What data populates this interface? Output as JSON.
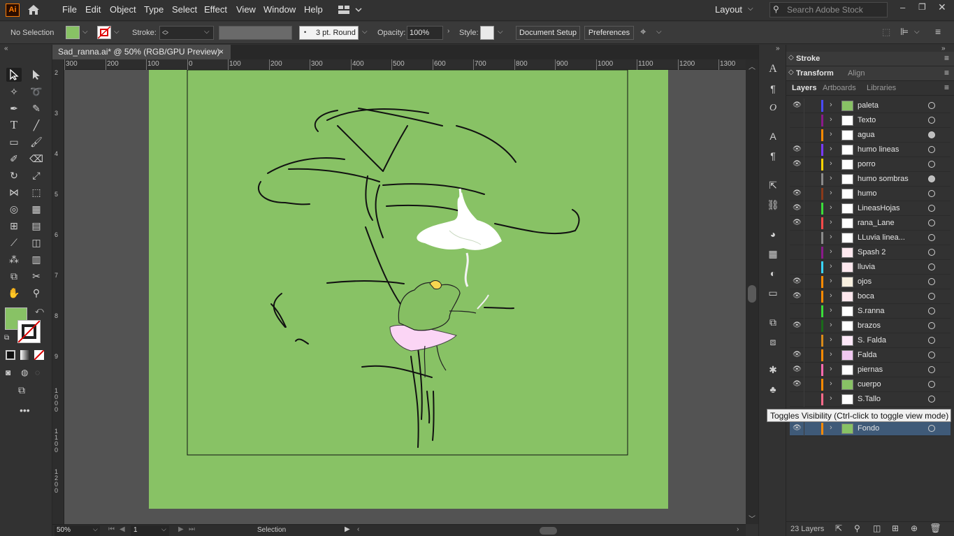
{
  "app": {
    "logo": "Ai"
  },
  "menu": [
    "File",
    "Edit",
    "Object",
    "Type",
    "Select",
    "Effect",
    "View",
    "Window",
    "Help"
  ],
  "workspace": "Layout",
  "search_placeholder": "Search Adobe Stock",
  "control": {
    "selection": "No Selection",
    "fill_color": "#88c265",
    "stroke_label": "Stroke:",
    "brush": "3 pt. Round",
    "opacity_label": "Opacity:",
    "opacity": "100%",
    "style_label": "Style:",
    "doc_setup": "Document Setup",
    "preferences": "Preferences"
  },
  "document_tab": {
    "title": "Sad_ranna.ai* @ 50% (RGB/GPU Preview)",
    "close": "×"
  },
  "ruler_h": [
    "300",
    "200",
    "100",
    "0",
    "100",
    "200",
    "300",
    "400",
    "500",
    "600",
    "700",
    "800",
    "900",
    "1000",
    "1100",
    "1200",
    "1300"
  ],
  "ruler_v": [
    "2",
    "3",
    "4",
    "5",
    "6",
    "7",
    "8",
    "9",
    "1\n0\n0\n0",
    "1\n1\n0\n0",
    "1\n2\n0\n0"
  ],
  "status": {
    "zoom": "50%",
    "artboard": "1",
    "tool": "Selection"
  },
  "panels": {
    "stroke": "Stroke",
    "transform": "Transform",
    "align": "Align",
    "layers": "Layers",
    "artboards": "Artboards",
    "libraries": "Libraries"
  },
  "layers": [
    {
      "name": "paleta",
      "color": "#4a4aff",
      "visible": true,
      "thumb": "#88c265"
    },
    {
      "name": "Texto",
      "color": "#8a1a8a",
      "visible": false,
      "thumb": "#ffffff"
    },
    {
      "name": "agua",
      "color": "#ff8a00",
      "visible": false,
      "thumb": "#ffffff"
    },
    {
      "name": "humo lineas",
      "color": "#7a3aff",
      "visible": true,
      "thumb": "#ffffff"
    },
    {
      "name": "porro",
      "color": "#ffd400",
      "visible": true,
      "thumb": "#ffffff"
    },
    {
      "name": "humo sombras",
      "color": "#8a8a8a",
      "visible": false,
      "thumb": "#ffffff"
    },
    {
      "name": "humo",
      "color": "#8a3a1a",
      "visible": true,
      "thumb": "#ffffff"
    },
    {
      "name": "LineasHojas",
      "color": "#3adc3a",
      "visible": true,
      "thumb": "#ffffff"
    },
    {
      "name": "rana_Lane",
      "color": "#ff4a4a",
      "visible": true,
      "thumb": "#ffffff"
    },
    {
      "name": "LLuvia linea...",
      "color": "#8a8a8a",
      "visible": false,
      "thumb": "#ffffff"
    },
    {
      "name": "Spash 2",
      "color": "#8a1a8a",
      "visible": false,
      "thumb": "#fde8ee"
    },
    {
      "name": "lluvia",
      "color": "#3ad6ff",
      "visible": false,
      "thumb": "#fde8ee"
    },
    {
      "name": "ojos",
      "color": "#ff8a00",
      "visible": true,
      "thumb": "#f8f0e0"
    },
    {
      "name": "boca",
      "color": "#ff8a00",
      "visible": true,
      "thumb": "#fde8ee"
    },
    {
      "name": "S.ranna",
      "color": "#3adc3a",
      "visible": false,
      "thumb": "#ffffff"
    },
    {
      "name": "brazos",
      "color": "#1a6a1a",
      "visible": true,
      "thumb": "#ffffff"
    },
    {
      "name": "S. Falda",
      "color": "#d88a1a",
      "visible": false,
      "thumb": "#fde8f8"
    },
    {
      "name": "Falda",
      "color": "#ff8a00",
      "visible": true,
      "thumb": "#f0c8f0"
    },
    {
      "name": "piernas",
      "color": "#ff6ab0",
      "visible": true,
      "thumb": "#ffffff"
    },
    {
      "name": "cuerpo",
      "color": "#ff8a00",
      "visible": true,
      "thumb": "#88c265"
    },
    {
      "name": "S.Tallo",
      "color": "#ff6a8a",
      "visible": false,
      "thumb": "#ffffff"
    },
    {
      "name": "Fondo",
      "color": "#ff8a00",
      "visible": true,
      "thumb": "#88c265"
    }
  ],
  "layers_count": "23 Layers",
  "tooltip": "Toggles Visibility (Ctrl-click to toggle view mode)"
}
